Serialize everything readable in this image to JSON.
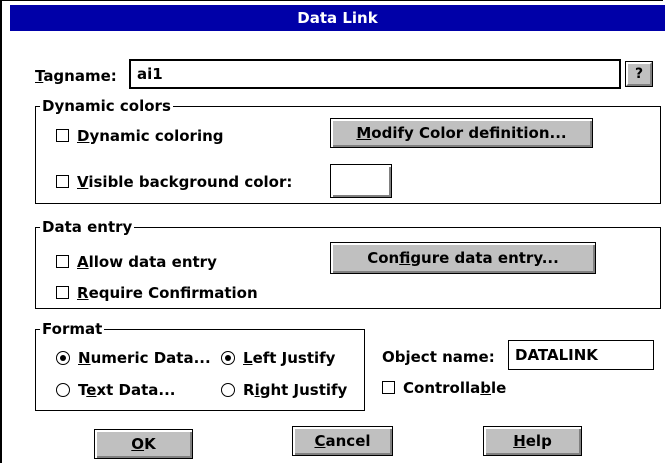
{
  "dialog": {
    "title": "Data Link"
  },
  "tagname": {
    "label": "Tagname:",
    "value": "ai1",
    "help_button": "?"
  },
  "dynamic_colors": {
    "title": "Dynamic colors",
    "dynamic_coloring": {
      "label": "Dynamic coloring",
      "checked": false
    },
    "visible_background": {
      "label": "Visible background color:",
      "checked": false
    },
    "modify_button": "Modify Color definition..."
  },
  "data_entry": {
    "title": "Data entry",
    "allow": {
      "label": "Allow data entry",
      "checked": false
    },
    "require": {
      "label": "Require Confirmation",
      "checked": false
    },
    "configure_button": "Configure data entry..."
  },
  "format": {
    "title": "Format",
    "numeric": {
      "label": "Numeric Data...",
      "selected": true
    },
    "text": {
      "label": "Text Data...",
      "selected": false
    },
    "left": {
      "label": "Left Justify",
      "selected": true
    },
    "right": {
      "label": "Right Justify",
      "selected": false
    }
  },
  "object": {
    "label": "Object name:",
    "value": "DATALINK",
    "controllable": {
      "label": "Controllable",
      "checked": false
    }
  },
  "buttons": {
    "ok": "OK",
    "cancel": "Cancel",
    "help": "Help"
  },
  "colors": {
    "title_bar": "#0000a8",
    "button_face": "#c0c0c0"
  }
}
